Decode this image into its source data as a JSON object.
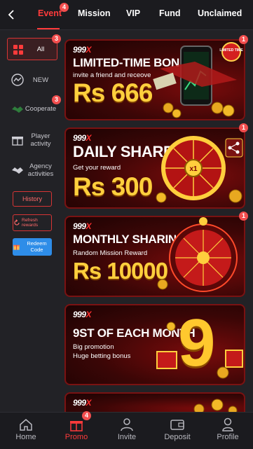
{
  "tabs": [
    {
      "label": "Event",
      "badge": "4",
      "active": true
    },
    {
      "label": "Mission"
    },
    {
      "label": "VIP"
    },
    {
      "label": "Fund"
    },
    {
      "label": "Unclaimed"
    }
  ],
  "sidebar": {
    "items": [
      {
        "label": "All",
        "badge": "3",
        "icon": "grid-icon",
        "active": true
      },
      {
        "label": "NEW",
        "icon": "messenger-icon"
      },
      {
        "label": "Cooperate",
        "badge": "3",
        "icon": "handshake-icon"
      },
      {
        "label": "Player activity",
        "icon": "gift-icon"
      },
      {
        "label": "Agency activities",
        "icon": "handshake-icon"
      }
    ],
    "history_label": "History",
    "refresh_label": "Refresh rewards",
    "redeem_label": "Redeem Code"
  },
  "banners": [
    {
      "brand": "999",
      "brand_suffix": "X",
      "title": "LIMITED-TIME BONUS",
      "subtitle": "invite a friend and receove",
      "amount": "Rs 666",
      "badge": "1",
      "tag": "LIMITED TIME"
    },
    {
      "brand": "999",
      "brand_suffix": "X",
      "title": "DAILY SHARE",
      "subtitle": "Get your reward",
      "amount": "Rs 300",
      "badge": "1",
      "wheel_center": "x1"
    },
    {
      "brand": "999",
      "brand_suffix": "X",
      "title": "MONTHLY SHARING",
      "subtitle": "Random Mission Reward",
      "amount": "Rs 10000",
      "badge": "1"
    },
    {
      "brand": "999",
      "brand_suffix": "X",
      "title": "9ST OF EACH MONTH",
      "subtitle": "Big promotion",
      "subtitle2": "Huge betting bonus",
      "big_number": "9"
    },
    {
      "brand": "999",
      "brand_suffix": "X"
    }
  ],
  "bottom_nav": [
    {
      "label": "Home",
      "icon": "home-icon"
    },
    {
      "label": "Promo",
      "icon": "gift-icon",
      "badge": "4",
      "active": true
    },
    {
      "label": "Invite",
      "icon": "invite-icon"
    },
    {
      "label": "Deposit",
      "icon": "wallet-icon"
    },
    {
      "label": "Profile",
      "icon": "profile-icon"
    }
  ],
  "colors": {
    "accent": "#ff3b3b",
    "background": "#222226",
    "banner_red": "#7a0b0b",
    "gold": "#ffcf3d",
    "redeem_blue": "#2e8de8"
  }
}
